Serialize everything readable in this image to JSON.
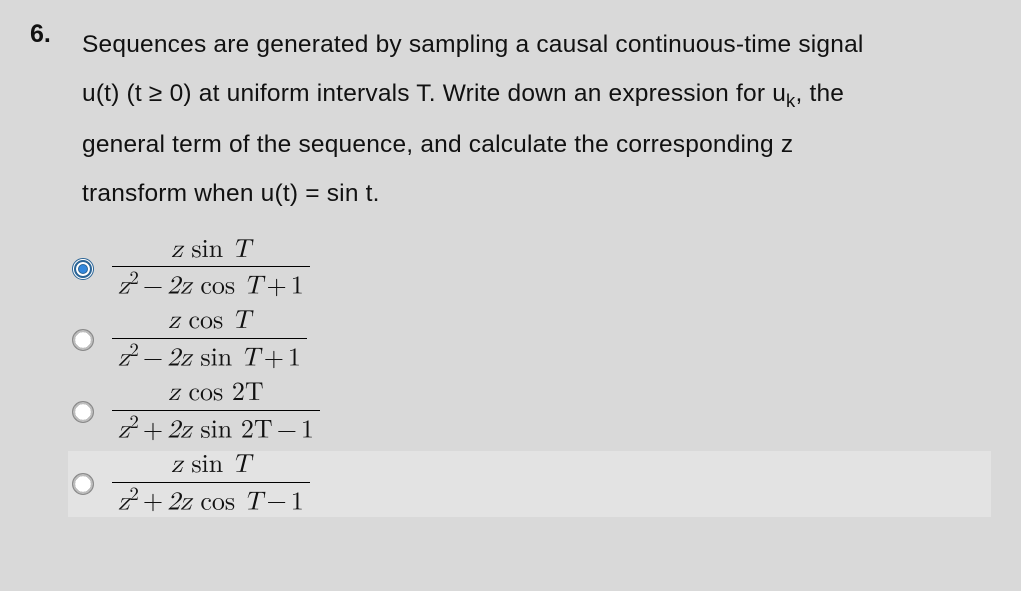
{
  "question": {
    "number": "6.",
    "text_line1_a": "Sequences are generated by sampling a causal continuous-time signal",
    "text_line2_a": "u(t) (t ≥ 0) at uniform intervals T. Write down an expression for u",
    "text_sub_k": "k",
    "text_line2_b": ", the",
    "text_line3": "general term of the sequence, and calculate the corresponding z",
    "text_line4": "transform when u(t) = sin t."
  },
  "options": [
    {
      "selected": true,
      "highlight": false,
      "num": {
        "z": "z",
        "fn": "sin",
        "arg": "T"
      },
      "den": {
        "z2": "z",
        "exp": "2",
        "op1": "−",
        "coef": "2z",
        "fn": "cos",
        "arg": "T",
        "op2": "+",
        "const": "1"
      }
    },
    {
      "selected": false,
      "highlight": false,
      "num": {
        "z": "z",
        "fn": "cos",
        "arg": "T"
      },
      "den": {
        "z2": "z",
        "exp": "2",
        "op1": "−",
        "coef": "2z",
        "fn": "sin",
        "arg": "T",
        "op2": "+",
        "const": "1"
      }
    },
    {
      "selected": false,
      "highlight": false,
      "num": {
        "z": "z",
        "fn": "cos",
        "arg": "2T"
      },
      "den": {
        "z2": "z",
        "exp": "2",
        "op1": "+",
        "coef": "2z",
        "fn": "sin",
        "arg": "2T",
        "op2": "−",
        "const": "1"
      }
    },
    {
      "selected": false,
      "highlight": true,
      "num": {
        "z": "z",
        "fn": "sin",
        "arg": "T"
      },
      "den": {
        "z2": "z",
        "exp": "2",
        "op1": "+",
        "coef": "2z",
        "fn": "cos",
        "arg": "T",
        "op2": "−",
        "const": "1"
      }
    }
  ]
}
